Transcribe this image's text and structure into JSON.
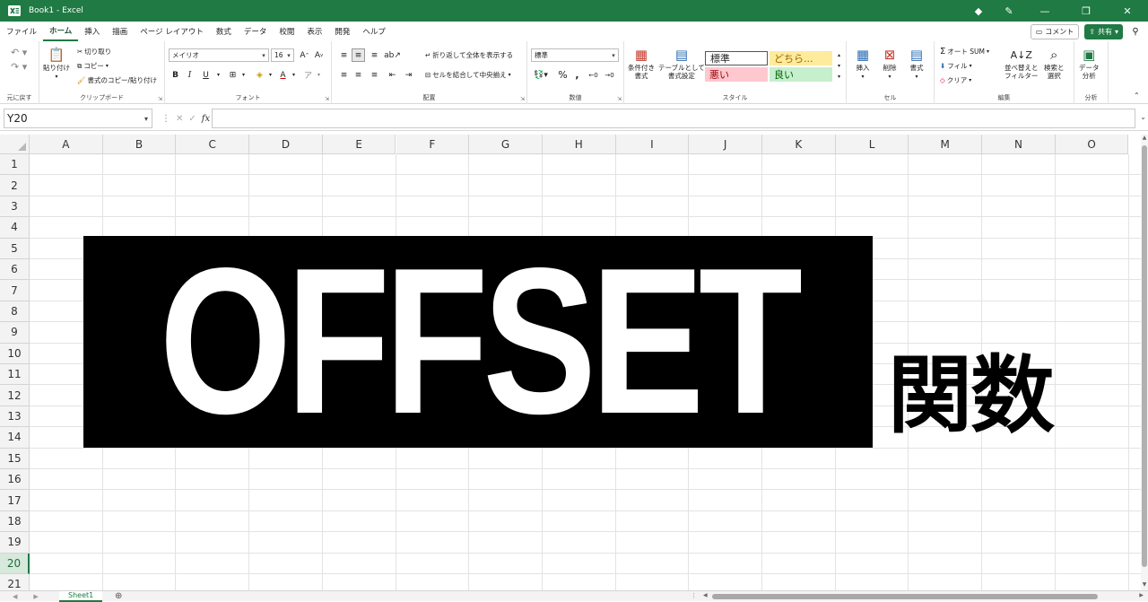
{
  "window": {
    "title": "Book1  -  Excel",
    "icons": [
      "diamond-icon",
      "pen-icon"
    ],
    "controls": [
      "minimize",
      "restore",
      "close"
    ],
    "accent": "#1f7a43"
  },
  "tabs": {
    "items": [
      "ファイル",
      "ホーム",
      "挿入",
      "描画",
      "ページ レイアウト",
      "数式",
      "データ",
      "校閲",
      "表示",
      "開発",
      "ヘルプ"
    ],
    "active": "ホーム",
    "comment_label": "コメント",
    "share_label": "共有"
  },
  "ribbon": {
    "undo": {
      "label": "元に戻す"
    },
    "clipboard": {
      "label": "クリップボード",
      "paste": "貼り付け",
      "cut": "切り取り",
      "copy": "コピー",
      "format_painter": "書式のコピー/貼り付け"
    },
    "font": {
      "label": "フォント",
      "name": "メイリオ",
      "size": "16",
      "bold": "B",
      "italic": "I",
      "underline": "U"
    },
    "alignment": {
      "label": "配置",
      "wrap": "折り返して全体を表示する",
      "merge": "セルを結合して中央揃え"
    },
    "number": {
      "label": "数値",
      "format": "標準"
    },
    "styles": {
      "label": "スタイル",
      "conditional": "条件付き\n書式",
      "as_table": "テーブルとして\n書式設定",
      "cells": [
        {
          "text": "標準",
          "bg": "#ffffff",
          "fg": "#000000"
        },
        {
          "text": "どちら...",
          "bg": "#ffeb9c",
          "fg": "#9c6500"
        },
        {
          "text": "悪い",
          "bg": "#ffc7ce",
          "fg": "#9c0006"
        },
        {
          "text": "良い",
          "bg": "#c6efce",
          "fg": "#006100"
        }
      ]
    },
    "cells": {
      "label": "セル",
      "insert": "挿入",
      "delete": "削除",
      "format": "書式"
    },
    "editing": {
      "label": "編集",
      "autosum": "オート SUM",
      "fill": "フィル",
      "clear": "クリア",
      "sort_filter": "並べ替えと\nフィルター",
      "find_select": "検索と\n選択"
    },
    "analysis": {
      "label": "分析",
      "data_analysis": "データ\n分析"
    }
  },
  "formula_bar": {
    "name_box": "Y20",
    "fx": "fx",
    "value": ""
  },
  "grid": {
    "columns": [
      "A",
      "B",
      "C",
      "D",
      "E",
      "F",
      "G",
      "H",
      "I",
      "J",
      "K",
      "L",
      "M",
      "N",
      "O"
    ],
    "rows": [
      "1",
      "2",
      "3",
      "4",
      "5",
      "6",
      "7",
      "8",
      "9",
      "10",
      "11",
      "12",
      "13",
      "14",
      "15",
      "16",
      "17",
      "18",
      "19",
      "20",
      "21"
    ],
    "active_row": "20"
  },
  "content": {
    "banner_text": "OFFSET",
    "banner_bg": "#000000",
    "banner_fg": "#ffffff",
    "subtitle": "関数"
  },
  "sheets": {
    "tabs": [
      "Sheet1"
    ],
    "active": "Sheet1"
  }
}
